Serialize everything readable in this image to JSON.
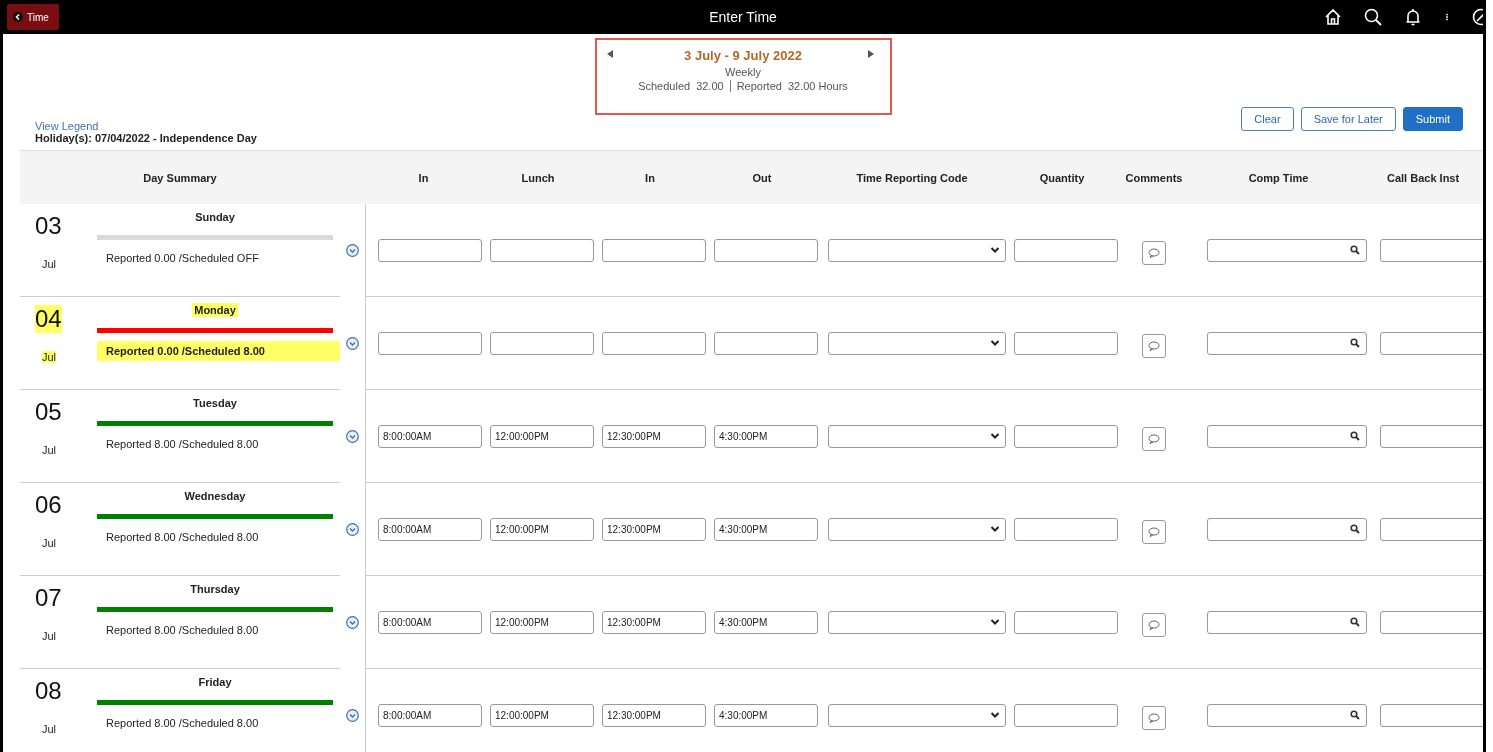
{
  "header": {
    "back_label": "Time",
    "title": "Enter Time"
  },
  "period": {
    "range": "3 July - 9 July 2022",
    "frequency": "Weekly",
    "scheduled_label": "Scheduled",
    "scheduled_value": "32.00",
    "reported_label": "Reported",
    "reported_value": "32.00 Hours"
  },
  "legend_link": "View Legend",
  "holiday_note": "Holiday(s): 07/04/2022 - Independence Day",
  "buttons": [
    {
      "label": "Clear",
      "kind": "secondary"
    },
    {
      "label": "Save for Later",
      "kind": "secondary"
    },
    {
      "label": "Submit",
      "kind": "primary"
    }
  ],
  "columns": [
    "Day Summary",
    "In",
    "Lunch",
    "In",
    "Out",
    "Time Reporting Code",
    "Quantity",
    "Comments",
    "Comp Time",
    "Call Back Inst"
  ],
  "days": [
    {
      "date": "03",
      "month": "Jul",
      "weekday": "Sunday",
      "summary": "Reported 0.00 /Scheduled OFF",
      "color": "#d9d9d9",
      "holiday": false
    },
    {
      "date": "04",
      "month": "Jul",
      "weekday": "Monday",
      "summary": "Reported 0.00 /Scheduled 8.00",
      "color": "#ff0000",
      "holiday": true
    },
    {
      "date": "05",
      "month": "Jul",
      "weekday": "Tuesday",
      "summary": "Reported 8.00 /Scheduled 8.00",
      "color": "#008000",
      "holiday": false,
      "times": [
        "8:00:00AM",
        "12:00:00PM",
        "12:30:00PM",
        "4:30:00PM"
      ]
    },
    {
      "date": "06",
      "month": "Jul",
      "weekday": "Wednesday",
      "summary": "Reported 8.00 /Scheduled 8.00",
      "color": "#008000",
      "holiday": false,
      "times": [
        "8:00:00AM",
        "12:00:00PM",
        "12:30:00PM",
        "4:30:00PM"
      ]
    },
    {
      "date": "07",
      "month": "Jul",
      "weekday": "Thursday",
      "summary": "Reported 8.00 /Scheduled 8.00",
      "color": "#008000",
      "holiday": false,
      "times": [
        "8:00:00AM",
        "12:00:00PM",
        "12:30:00PM",
        "4:30:00PM"
      ]
    },
    {
      "date": "08",
      "month": "Jul",
      "weekday": "Friday",
      "summary": "Reported 8.00 /Scheduled 8.00",
      "color": "#008000",
      "holiday": false,
      "times": [
        "8:00:00AM",
        "12:00:00PM",
        "12:30:00PM",
        "4:30:00PM"
      ]
    }
  ]
}
